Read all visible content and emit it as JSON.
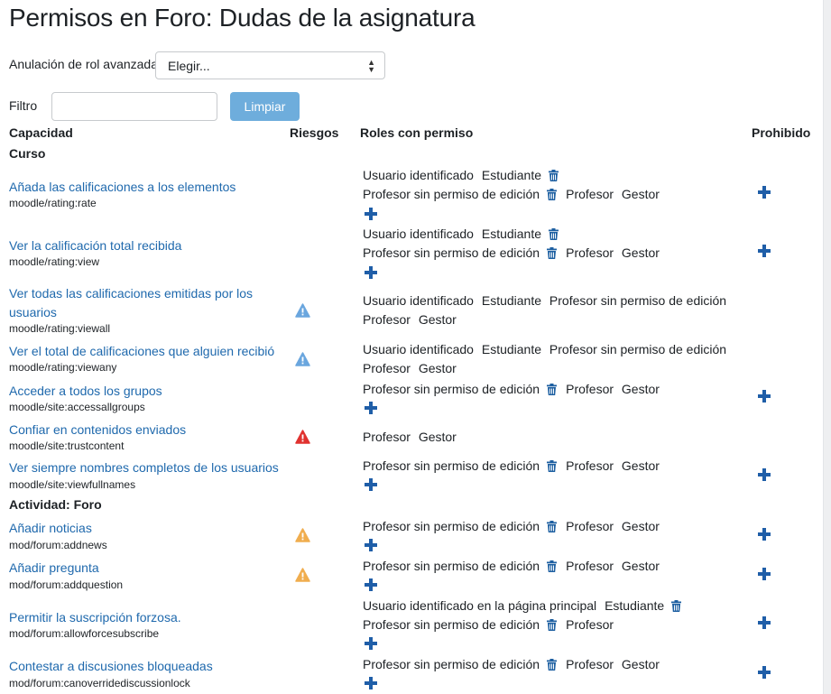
{
  "page": {
    "title": "Permisos en Foro: Dudas de la asignatura"
  },
  "advanced": {
    "label": "Anulación de rol avanzada",
    "selected": "Elegir..."
  },
  "filter": {
    "label": "Filtro",
    "value": "",
    "clear_label": "Limpiar"
  },
  "table": {
    "headers": {
      "capability": "Capacidad",
      "risks": "Riesgos",
      "roles": "Roles con permiso",
      "prohibited": "Prohibido"
    },
    "sections": [
      "Curso",
      "Actividad: Foro"
    ]
  },
  "rows": [
    {
      "name": "Añada las calificaciones a los elementos",
      "id": "moodle/rating:rate",
      "lines": [
        [
          {
            "t": "Usuario identificado"
          },
          {
            "t": "Estudiante",
            "del": true
          }
        ],
        [
          {
            "t": "Profesor sin permiso de edición",
            "del": true
          },
          {
            "t": "Profesor"
          },
          {
            "t": "Gestor"
          }
        ]
      ]
    },
    {
      "name": "Ver la calificación total recibida",
      "id": "moodle/rating:view",
      "lines": [
        [
          {
            "t": "Usuario identificado"
          },
          {
            "t": "Estudiante",
            "del": true
          }
        ],
        [
          {
            "t": "Profesor sin permiso de edición",
            "del": true
          },
          {
            "t": "Profesor"
          },
          {
            "t": "Gestor"
          }
        ]
      ]
    },
    {
      "name": "Ver todas las calificaciones emitidas por los usuarios",
      "id": "moodle/rating:viewall",
      "lines": [
        [
          {
            "t": "Usuario identificado"
          },
          {
            "t": "Estudiante"
          },
          {
            "t": "Profesor sin permiso de edición"
          }
        ],
        [
          {
            "t": "Profesor"
          },
          {
            "t": "Gestor"
          }
        ]
      ]
    },
    {
      "name": "Ver el total de calificaciones que alguien recibió",
      "id": "moodle/rating:viewany",
      "lines": [
        [
          {
            "t": "Usuario identificado"
          },
          {
            "t": "Estudiante"
          },
          {
            "t": "Profesor sin permiso de edición"
          }
        ],
        [
          {
            "t": "Profesor"
          },
          {
            "t": "Gestor"
          }
        ]
      ]
    },
    {
      "name": "Acceder a todos los grupos",
      "id": "moodle/site:accessallgroups",
      "lines": [
        [
          {
            "t": "Profesor sin permiso de edición",
            "del": true
          },
          {
            "t": "Profesor"
          },
          {
            "t": "Gestor"
          }
        ]
      ]
    },
    {
      "name": "Confiar en contenidos enviados",
      "id": "moodle/site:trustcontent",
      "lines": [
        [
          {
            "t": "Profesor"
          },
          {
            "t": "Gestor"
          }
        ]
      ]
    },
    {
      "name": "Ver siempre nombres completos de los usuarios",
      "id": "moodle/site:viewfullnames",
      "lines": [
        [
          {
            "t": "Profesor sin permiso de edición",
            "del": true
          },
          {
            "t": "Profesor"
          },
          {
            "t": "Gestor"
          }
        ]
      ]
    },
    {
      "name": "Añadir noticias",
      "id": "mod/forum:addnews",
      "lines": [
        [
          {
            "t": "Profesor sin permiso de edición",
            "del": true
          },
          {
            "t": "Profesor"
          },
          {
            "t": "Gestor"
          }
        ]
      ]
    },
    {
      "name": "Añadir pregunta",
      "id": "mod/forum:addquestion",
      "lines": [
        [
          {
            "t": "Profesor sin permiso de edición",
            "del": true
          },
          {
            "t": "Profesor"
          },
          {
            "t": "Gestor"
          }
        ]
      ]
    },
    {
      "name": "Permitir la suscripción forzosa.",
      "id": "mod/forum:allowforcesubscribe",
      "lines": [
        [
          {
            "t": "Usuario identificado en la página principal"
          },
          {
            "t": "Estudiante",
            "del": true
          }
        ],
        [
          {
            "t": "Profesor sin permiso de edición",
            "del": true
          },
          {
            "t": "Profesor"
          }
        ]
      ]
    },
    {
      "name": "Contestar a discusiones bloqueadas",
      "id": "mod/forum:canoverridediscussionlock",
      "lines": [
        [
          {
            "t": "Profesor sin permiso de edición",
            "del": true
          },
          {
            "t": "Profesor"
          },
          {
            "t": "Gestor"
          }
        ]
      ]
    }
  ],
  "icons": {
    "risk": "risk-triangle-icon",
    "delete": "trash-icon",
    "add": "plus-icon"
  },
  "colors": {
    "link": "#1f69ad",
    "button": "#6eaddc",
    "trash": "#1d5fa1",
    "plus": "#1f5ea8",
    "risk_info": "#6aa6de",
    "risk_warn": "#f0ad4e",
    "risk_danger": "#e0322f"
  }
}
